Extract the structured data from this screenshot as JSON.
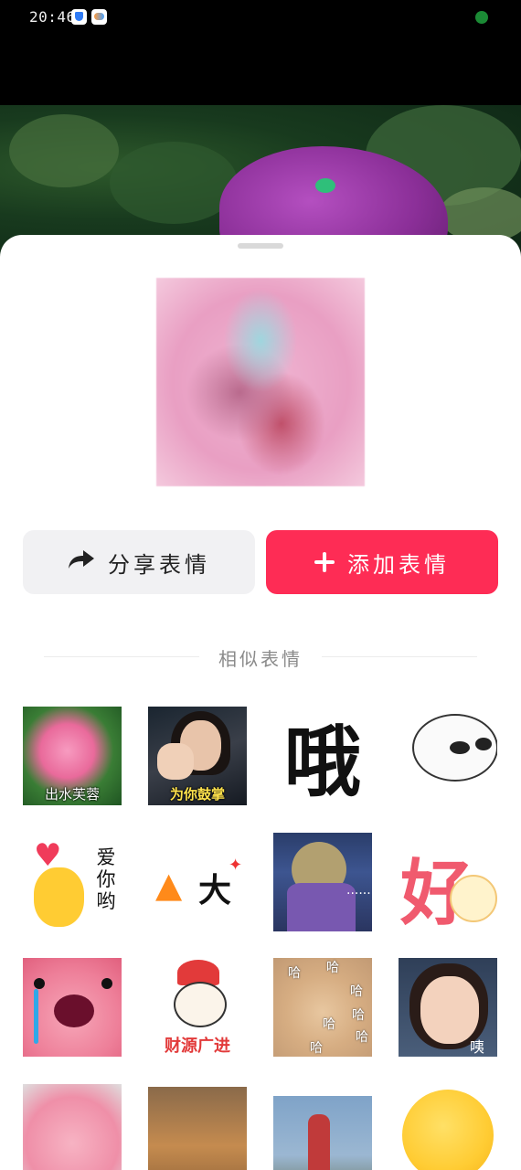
{
  "status_bar": {
    "time": "20:46",
    "icons": [
      "shield-icon",
      "game-icon",
      "mic-indicator-icon"
    ]
  },
  "actions": {
    "share_label": "分享表情",
    "add_label": "添加表情"
  },
  "similar": {
    "title": "相似表情",
    "items": [
      {
        "name": "flower",
        "caption": "出水芙蓉"
      },
      {
        "name": "clap",
        "caption": "为你鼓掌"
      },
      {
        "name": "e",
        "text": "哦"
      },
      {
        "name": "blob"
      },
      {
        "name": "love",
        "text": "爱你哟"
      },
      {
        "name": "big",
        "text": "大"
      },
      {
        "name": "frog",
        "text": "......"
      },
      {
        "name": "hao",
        "text": "好"
      },
      {
        "name": "cry"
      },
      {
        "name": "wealth",
        "text": "财源广进"
      },
      {
        "name": "cat",
        "text": "哈"
      },
      {
        "name": "girl",
        "text": "咦"
      },
      {
        "name": "beaver"
      },
      {
        "name": "dog"
      },
      {
        "name": "ultra"
      },
      {
        "name": "smile"
      }
    ]
  },
  "colors": {
    "accent": "#fe2c55",
    "share_bg": "#f1f1f3"
  }
}
